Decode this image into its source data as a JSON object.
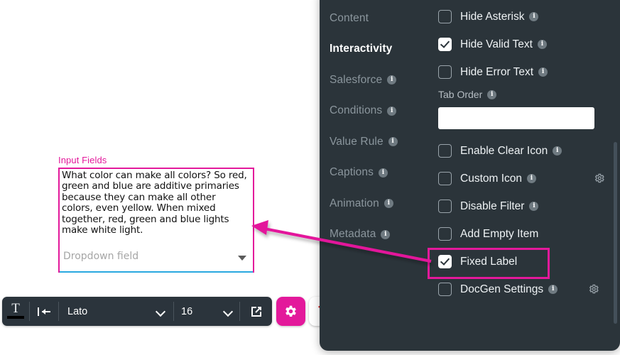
{
  "canvas": {
    "input_fields_label": "Input Fields",
    "textarea_value": "What color can make all colors? So red, green and blue are additive primaries because they can make all other colors, even yellow. When mixed together, red, green and blue lights make white light.",
    "dropdown_placeholder": "Dropdown field",
    "highlight_color": "#e3199b",
    "underline_color": "#29a8e0"
  },
  "toolbar": {
    "text_style_icon": "text-format-icon",
    "indent_icon": "indent-left-icon",
    "font_family_value": "Lato",
    "font_size_value": "16",
    "open_external_icon": "external-link-icon",
    "settings_icon": "gear-icon",
    "delete_icon": "trash-icon",
    "settings_button_color": "#e3199b",
    "delete_icon_color": "#e02020"
  },
  "panel": {
    "background": "#2b343a",
    "tabs": [
      {
        "label": "Content",
        "active": false,
        "info": false
      },
      {
        "label": "Interactivity",
        "active": true,
        "info": false
      },
      {
        "label": "Salesforce",
        "active": false,
        "info": true
      },
      {
        "label": "Conditions",
        "active": false,
        "info": true
      },
      {
        "label": "Value Rule",
        "active": false,
        "info": true
      },
      {
        "label": "Captions",
        "active": false,
        "info": true
      },
      {
        "label": "Animation",
        "active": false,
        "info": true
      },
      {
        "label": "Metadata",
        "active": false,
        "info": true
      }
    ],
    "options": [
      {
        "label": "Hide Asterisk",
        "checked": false,
        "info": true,
        "gear": false
      },
      {
        "label": "Hide Valid Text",
        "checked": true,
        "info": true,
        "gear": false
      },
      {
        "label": "Hide Error Text",
        "checked": false,
        "info": true,
        "gear": false
      }
    ],
    "tab_order": {
      "label": "Tab Order",
      "info": true,
      "value": "",
      "placeholder": ""
    },
    "options2": [
      {
        "label": "Enable Clear Icon",
        "checked": false,
        "info": true,
        "gear": false
      },
      {
        "label": "Custom Icon",
        "checked": false,
        "info": true,
        "gear": true
      },
      {
        "label": "Disable Filter",
        "checked": false,
        "info": true,
        "gear": false
      },
      {
        "label": "Add Empty Item",
        "checked": false,
        "info": false,
        "gear": false
      },
      {
        "label": "Fixed Label",
        "checked": true,
        "info": false,
        "gear": false,
        "highlighted": true
      },
      {
        "label": "DocGen Settings",
        "checked": false,
        "info": true,
        "gear": true
      }
    ],
    "info_icon": "info-icon",
    "gear_icon": "gear-icon",
    "scrollbar": "vertical-scrollbar"
  },
  "annotation": {
    "color": "#e3199b",
    "arrow_name": "annotation-arrow"
  }
}
